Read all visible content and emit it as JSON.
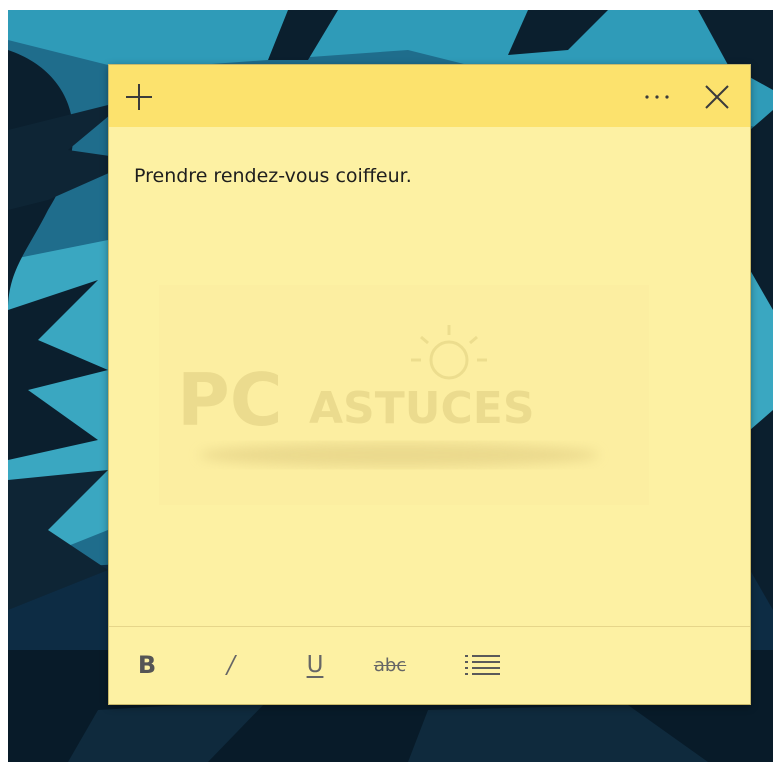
{
  "note": {
    "add_icon": "plus-icon",
    "more_icon": "ellipsis-icon",
    "close_icon": "close-icon",
    "text": "Prendre rendez-vous coiffeur.",
    "background_color": "#fdf1a3",
    "header_color": "#fce26d"
  },
  "watermark": {
    "brand_pc": "PC",
    "brand_astuces": "ASTUCES"
  },
  "toolbar": {
    "bold_label": "B",
    "italic_label": "/",
    "underline_label": "U",
    "strikethrough_label": "abc",
    "list_icon": "bulleted-list-icon"
  }
}
